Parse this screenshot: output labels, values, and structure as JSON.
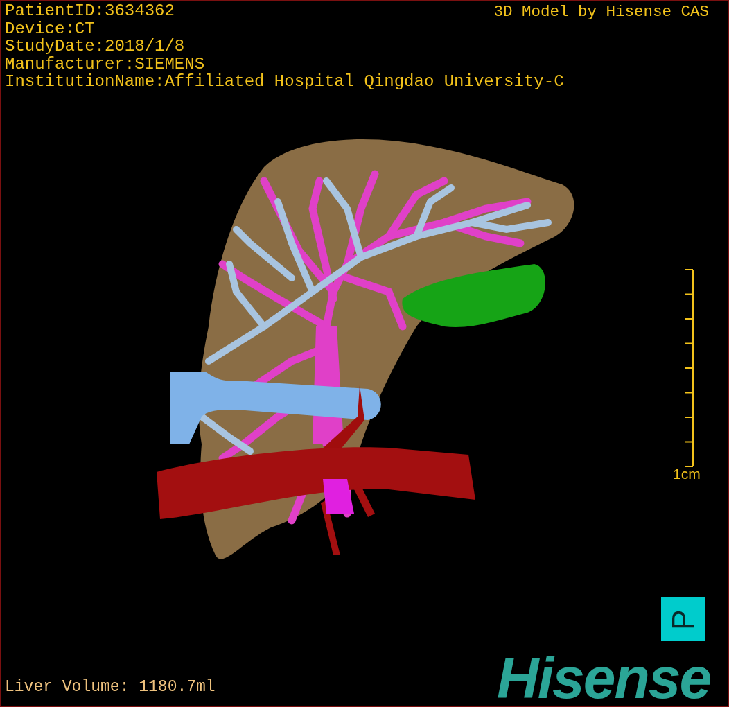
{
  "study_info": [
    "PatientID:3634362",
    "Device:CT",
    "StudyDate:2018/1/8",
    "Manufacturer:SIEMENS",
    "InstitutionName:Affiliated Hospital Qingdao University-C"
  ],
  "viewer_title": "3D Model by Hisense CAS",
  "scale_bar": {
    "label": "1cm"
  },
  "orientation_cube": {
    "label": "P"
  },
  "liver_volume": "Liver Volume: 1180.7ml",
  "logo": "Hisense"
}
